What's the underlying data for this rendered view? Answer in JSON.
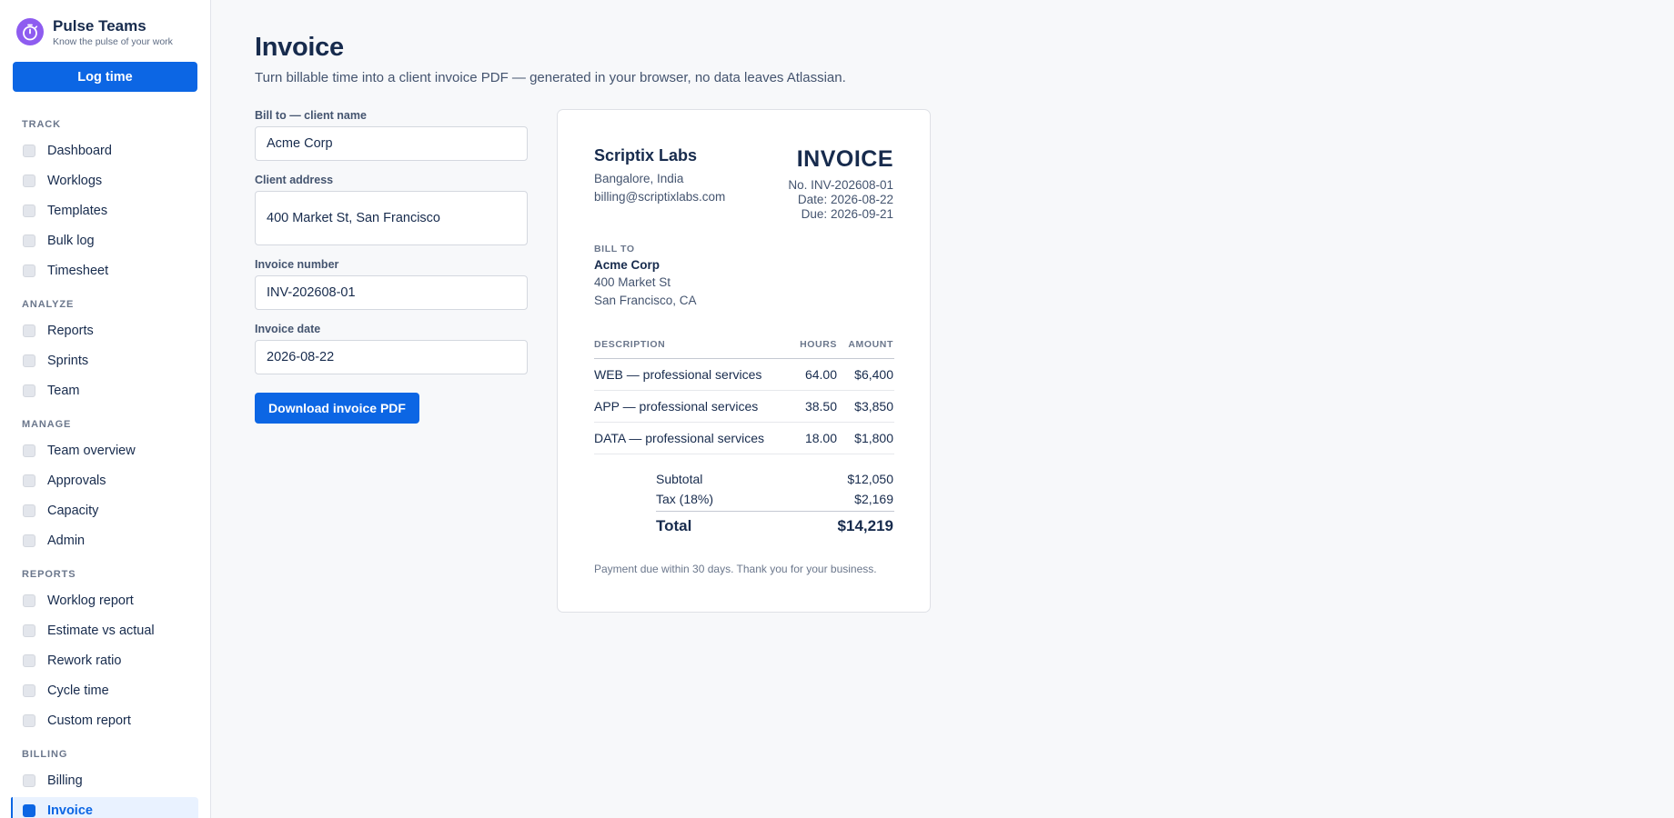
{
  "app": {
    "name": "Pulse Teams",
    "tagline": "Know the pulse of your work",
    "log_button": "Log time",
    "accent": "#0c66e4",
    "logo_color": "#8e5cf0"
  },
  "sidebar": {
    "sections": [
      {
        "title": "TRACK",
        "items": [
          "Dashboard",
          "Worklogs",
          "Templates",
          "Bulk log",
          "Timesheet"
        ]
      },
      {
        "title": "ANALYZE",
        "items": [
          "Reports",
          "Sprints",
          "Team"
        ]
      },
      {
        "title": "MANAGE",
        "items": [
          "Team overview",
          "Approvals",
          "Capacity",
          "Admin"
        ]
      },
      {
        "title": "REPORTS",
        "items": [
          "Worklog report",
          "Estimate vs actual",
          "Rework ratio",
          "Cycle time",
          "Custom report"
        ]
      },
      {
        "title": "BILLING",
        "items": [
          "Billing",
          "Invoice"
        ]
      }
    ],
    "active_item": "Invoice"
  },
  "main": {
    "title": "Invoice",
    "subtitle": "Turn billable time into a client invoice PDF — generated in your browser, no data leaves Atlassian."
  },
  "form": {
    "client_name_label": "Bill to — client name",
    "client_name": "Acme Corp",
    "client_address_label": "Client address",
    "client_address": "400 Market St, San Francisco",
    "invoice_number_label": "Invoice number",
    "invoice_number": "INV-202608-01",
    "invoice_date_label": "Invoice date",
    "invoice_date": "2026-08-22",
    "download_button": "Download invoice PDF"
  },
  "preview": {
    "company": "Scriptix Labs",
    "company_address": "Bangalore, India",
    "company_email": "billing@scriptixlabs.com",
    "heading": "INVOICE",
    "number_line": "No. INV-202608-01",
    "date_line": "Date: 2026-08-22",
    "due_line": "Due: 2026-09-21",
    "bill_to_label": "BILL TO",
    "bill_to_name": "Acme Corp",
    "bill_to_line1": "400 Market St",
    "bill_to_line2": "San Francisco, CA",
    "columns": {
      "description": "DESCRIPTION",
      "hours": "HOURS",
      "amount": "AMOUNT"
    },
    "lines": [
      {
        "description": "WEB — professional services",
        "hours": "64.00",
        "amount": "$6,400"
      },
      {
        "description": "APP — professional services",
        "hours": "38.50",
        "amount": "$3,850"
      },
      {
        "description": "DATA — professional services",
        "hours": "18.00",
        "amount": "$1,800"
      }
    ],
    "subtotal_label": "Subtotal",
    "subtotal": "$12,050",
    "tax_label": "Tax (18%)",
    "tax": "$2,169",
    "total_label": "Total",
    "total": "$14,219",
    "footer": "Payment due within 30 days. Thank you for your business."
  }
}
